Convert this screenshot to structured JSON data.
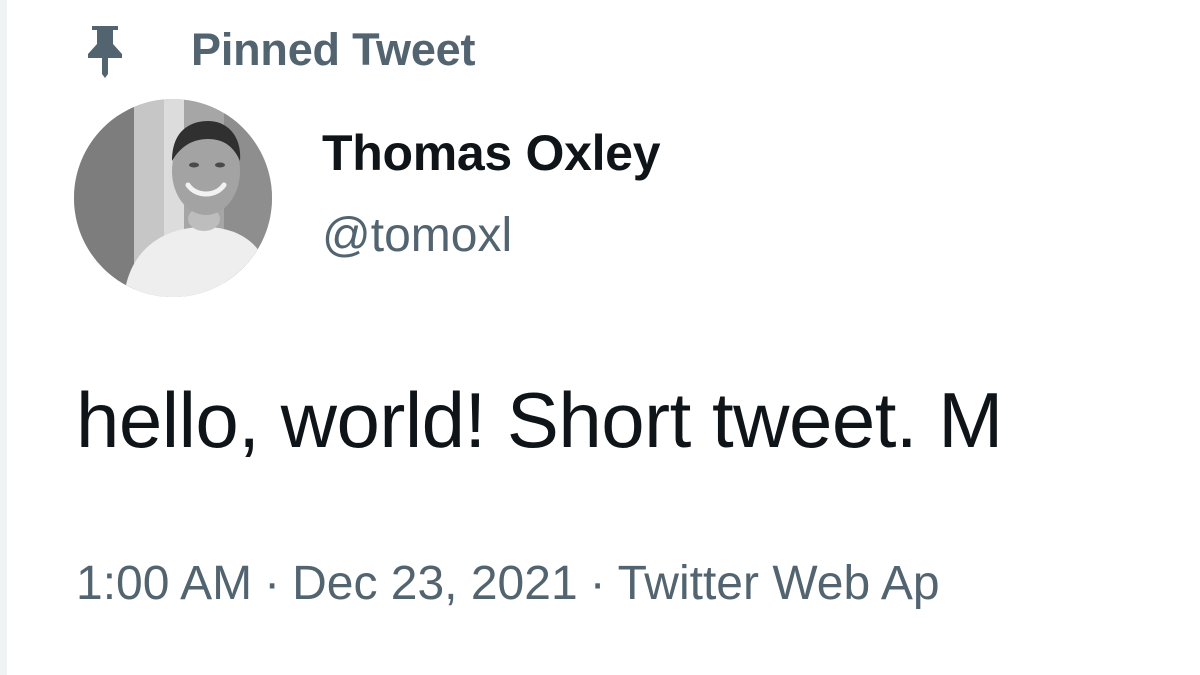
{
  "pinned": {
    "icon": "pin-icon",
    "label": "Pinned Tweet"
  },
  "author": {
    "avatar": "avatar",
    "display_name": "Thomas Oxley",
    "handle": "@tomoxl"
  },
  "tweet": {
    "text": "hello, world! Short tweet. M"
  },
  "meta": {
    "time": "1:00 AM",
    "separator": "·",
    "date": "Dec 23, 2021",
    "source": "Twitter Web Ap"
  },
  "colors": {
    "primary_text": "#0f1419",
    "secondary_text": "#536471",
    "background": "#ffffff"
  }
}
